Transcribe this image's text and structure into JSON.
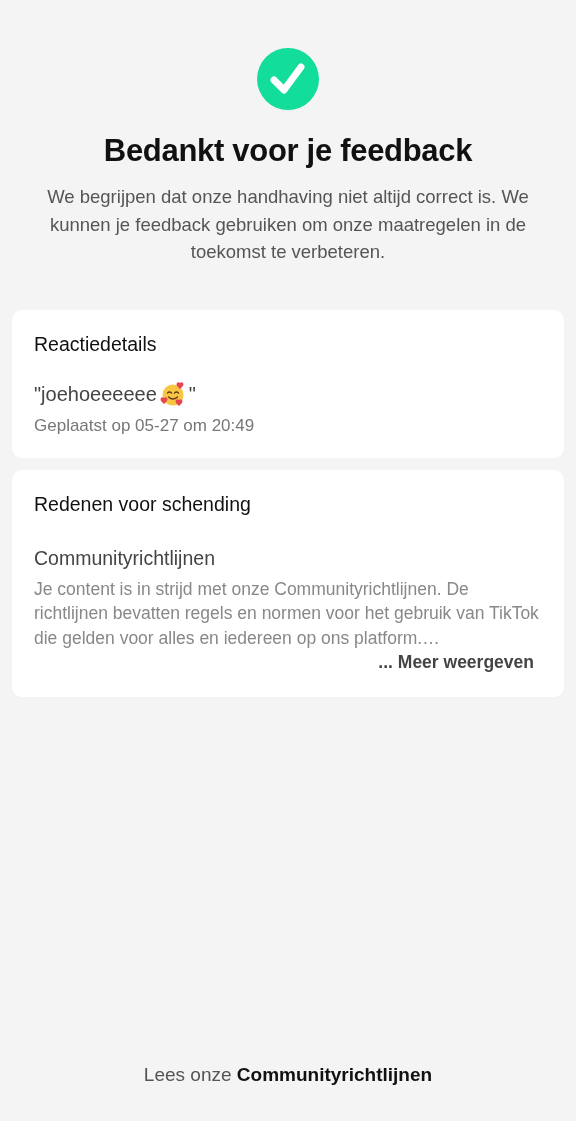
{
  "header": {
    "title": "Bedankt voor je feedback",
    "message": "We begrijpen dat onze handhaving niet altijd correct is. We kunnen je feedback gebruiken om onze maatregelen in de toekomst te verbeteren."
  },
  "comment_card": {
    "heading": "Reactiedetails",
    "comment_before_emoji": "\"joehoeeeeee",
    "comment_after_emoji": "\"",
    "posted": "Geplaatst op 05-27 om 20:49"
  },
  "reasons_card": {
    "heading": "Redenen voor schending",
    "reason": "Communityrichtlijnen",
    "description": "Je content is in strijd met onze Communityrichtlijnen. De richtlijnen bevatten regels en normen voor het gebruik van TikTok die gelden voor alles en iedereen op ons platform.…",
    "more_link": "... Meer weergeven"
  },
  "footer": {
    "text": "Lees onze",
    "link": "Communityrichtlijnen"
  }
}
